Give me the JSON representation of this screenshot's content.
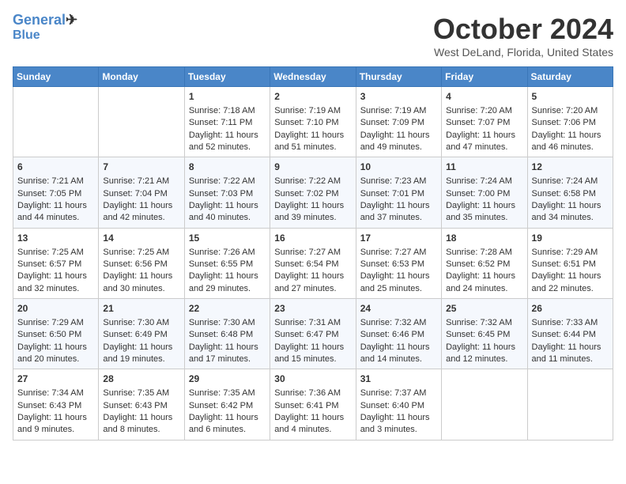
{
  "header": {
    "logo_line1": "General",
    "logo_line2": "Blue",
    "month": "October 2024",
    "location": "West DeLand, Florida, United States"
  },
  "days_of_week": [
    "Sunday",
    "Monday",
    "Tuesday",
    "Wednesday",
    "Thursday",
    "Friday",
    "Saturday"
  ],
  "weeks": [
    [
      {
        "day": "",
        "sunrise": "",
        "sunset": "",
        "daylight": ""
      },
      {
        "day": "",
        "sunrise": "",
        "sunset": "",
        "daylight": ""
      },
      {
        "day": "1",
        "sunrise": "Sunrise: 7:18 AM",
        "sunset": "Sunset: 7:11 PM",
        "daylight": "Daylight: 11 hours and 52 minutes."
      },
      {
        "day": "2",
        "sunrise": "Sunrise: 7:19 AM",
        "sunset": "Sunset: 7:10 PM",
        "daylight": "Daylight: 11 hours and 51 minutes."
      },
      {
        "day": "3",
        "sunrise": "Sunrise: 7:19 AM",
        "sunset": "Sunset: 7:09 PM",
        "daylight": "Daylight: 11 hours and 49 minutes."
      },
      {
        "day": "4",
        "sunrise": "Sunrise: 7:20 AM",
        "sunset": "Sunset: 7:07 PM",
        "daylight": "Daylight: 11 hours and 47 minutes."
      },
      {
        "day": "5",
        "sunrise": "Sunrise: 7:20 AM",
        "sunset": "Sunset: 7:06 PM",
        "daylight": "Daylight: 11 hours and 46 minutes."
      }
    ],
    [
      {
        "day": "6",
        "sunrise": "Sunrise: 7:21 AM",
        "sunset": "Sunset: 7:05 PM",
        "daylight": "Daylight: 11 hours and 44 minutes."
      },
      {
        "day": "7",
        "sunrise": "Sunrise: 7:21 AM",
        "sunset": "Sunset: 7:04 PM",
        "daylight": "Daylight: 11 hours and 42 minutes."
      },
      {
        "day": "8",
        "sunrise": "Sunrise: 7:22 AM",
        "sunset": "Sunset: 7:03 PM",
        "daylight": "Daylight: 11 hours and 40 minutes."
      },
      {
        "day": "9",
        "sunrise": "Sunrise: 7:22 AM",
        "sunset": "Sunset: 7:02 PM",
        "daylight": "Daylight: 11 hours and 39 minutes."
      },
      {
        "day": "10",
        "sunrise": "Sunrise: 7:23 AM",
        "sunset": "Sunset: 7:01 PM",
        "daylight": "Daylight: 11 hours and 37 minutes."
      },
      {
        "day": "11",
        "sunrise": "Sunrise: 7:24 AM",
        "sunset": "Sunset: 7:00 PM",
        "daylight": "Daylight: 11 hours and 35 minutes."
      },
      {
        "day": "12",
        "sunrise": "Sunrise: 7:24 AM",
        "sunset": "Sunset: 6:58 PM",
        "daylight": "Daylight: 11 hours and 34 minutes."
      }
    ],
    [
      {
        "day": "13",
        "sunrise": "Sunrise: 7:25 AM",
        "sunset": "Sunset: 6:57 PM",
        "daylight": "Daylight: 11 hours and 32 minutes."
      },
      {
        "day": "14",
        "sunrise": "Sunrise: 7:25 AM",
        "sunset": "Sunset: 6:56 PM",
        "daylight": "Daylight: 11 hours and 30 minutes."
      },
      {
        "day": "15",
        "sunrise": "Sunrise: 7:26 AM",
        "sunset": "Sunset: 6:55 PM",
        "daylight": "Daylight: 11 hours and 29 minutes."
      },
      {
        "day": "16",
        "sunrise": "Sunrise: 7:27 AM",
        "sunset": "Sunset: 6:54 PM",
        "daylight": "Daylight: 11 hours and 27 minutes."
      },
      {
        "day": "17",
        "sunrise": "Sunrise: 7:27 AM",
        "sunset": "Sunset: 6:53 PM",
        "daylight": "Daylight: 11 hours and 25 minutes."
      },
      {
        "day": "18",
        "sunrise": "Sunrise: 7:28 AM",
        "sunset": "Sunset: 6:52 PM",
        "daylight": "Daylight: 11 hours and 24 minutes."
      },
      {
        "day": "19",
        "sunrise": "Sunrise: 7:29 AM",
        "sunset": "Sunset: 6:51 PM",
        "daylight": "Daylight: 11 hours and 22 minutes."
      }
    ],
    [
      {
        "day": "20",
        "sunrise": "Sunrise: 7:29 AM",
        "sunset": "Sunset: 6:50 PM",
        "daylight": "Daylight: 11 hours and 20 minutes."
      },
      {
        "day": "21",
        "sunrise": "Sunrise: 7:30 AM",
        "sunset": "Sunset: 6:49 PM",
        "daylight": "Daylight: 11 hours and 19 minutes."
      },
      {
        "day": "22",
        "sunrise": "Sunrise: 7:30 AM",
        "sunset": "Sunset: 6:48 PM",
        "daylight": "Daylight: 11 hours and 17 minutes."
      },
      {
        "day": "23",
        "sunrise": "Sunrise: 7:31 AM",
        "sunset": "Sunset: 6:47 PM",
        "daylight": "Daylight: 11 hours and 15 minutes."
      },
      {
        "day": "24",
        "sunrise": "Sunrise: 7:32 AM",
        "sunset": "Sunset: 6:46 PM",
        "daylight": "Daylight: 11 hours and 14 minutes."
      },
      {
        "day": "25",
        "sunrise": "Sunrise: 7:32 AM",
        "sunset": "Sunset: 6:45 PM",
        "daylight": "Daylight: 11 hours and 12 minutes."
      },
      {
        "day": "26",
        "sunrise": "Sunrise: 7:33 AM",
        "sunset": "Sunset: 6:44 PM",
        "daylight": "Daylight: 11 hours and 11 minutes."
      }
    ],
    [
      {
        "day": "27",
        "sunrise": "Sunrise: 7:34 AM",
        "sunset": "Sunset: 6:43 PM",
        "daylight": "Daylight: 11 hours and 9 minutes."
      },
      {
        "day": "28",
        "sunrise": "Sunrise: 7:35 AM",
        "sunset": "Sunset: 6:43 PM",
        "daylight": "Daylight: 11 hours and 8 minutes."
      },
      {
        "day": "29",
        "sunrise": "Sunrise: 7:35 AM",
        "sunset": "Sunset: 6:42 PM",
        "daylight": "Daylight: 11 hours and 6 minutes."
      },
      {
        "day": "30",
        "sunrise": "Sunrise: 7:36 AM",
        "sunset": "Sunset: 6:41 PM",
        "daylight": "Daylight: 11 hours and 4 minutes."
      },
      {
        "day": "31",
        "sunrise": "Sunrise: 7:37 AM",
        "sunset": "Sunset: 6:40 PM",
        "daylight": "Daylight: 11 hours and 3 minutes."
      },
      {
        "day": "",
        "sunrise": "",
        "sunset": "",
        "daylight": ""
      },
      {
        "day": "",
        "sunrise": "",
        "sunset": "",
        "daylight": ""
      }
    ]
  ]
}
